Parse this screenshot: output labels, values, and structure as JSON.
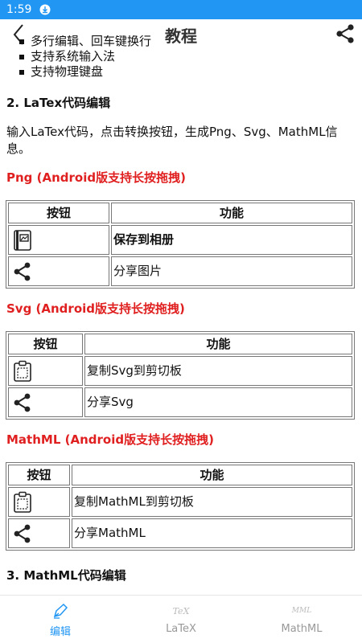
{
  "status": {
    "time": "1:59"
  },
  "appbar": {
    "title": "教程"
  },
  "bullets": [
    "多行编辑、回车键换行",
    "支持系统输入法",
    "支持物理键盘"
  ],
  "section2": {
    "heading": "2. LaTex代码编辑",
    "paragraph": "输入LaTex代码，点击转换按钮，生成Png、Svg、MathML信息。"
  },
  "tables": {
    "header_button": "按钮",
    "header_function": "功能",
    "png": {
      "title": "Png (Android版支持长按拖拽)",
      "rows": [
        {
          "icon": "save-album-icon",
          "label": "保存到相册"
        },
        {
          "icon": "share-icon",
          "label": "分享图片"
        }
      ]
    },
    "svg": {
      "title": "Svg (Android版支持长按拖拽)",
      "rows": [
        {
          "icon": "clipboard-icon",
          "label": "复制Svg到剪切板"
        },
        {
          "icon": "share-icon",
          "label": "分享Svg"
        }
      ]
    },
    "mathml": {
      "title": "MathML (Android版支持长按拖拽)",
      "rows": [
        {
          "icon": "clipboard-icon",
          "label": "复制MathML到剪切板"
        },
        {
          "icon": "share-icon",
          "label": "分享MathML"
        }
      ]
    }
  },
  "section3": {
    "heading": "3. MathML代码编辑"
  },
  "bottom_nav": [
    {
      "label": "编辑",
      "icon": "pen-icon",
      "active": true
    },
    {
      "label": "LaTeX",
      "icon_text": "TeX",
      "active": false
    },
    {
      "label": "MathML",
      "icon_text": "MML",
      "active": false
    }
  ],
  "colors": {
    "status_bar": "#2196f3",
    "accent": "#2196f3",
    "section_red": "#e02020"
  }
}
